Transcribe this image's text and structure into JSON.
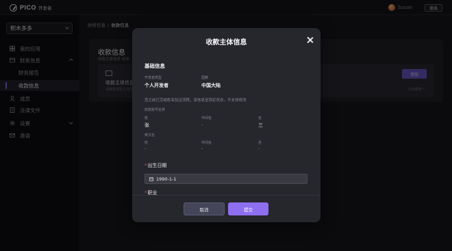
{
  "topbar": {
    "logo_text": "PICO",
    "logo_sub": "开发者",
    "username": "Susan",
    "logout_label": "退出"
  },
  "sidebar": {
    "app_name": "积木多多",
    "items": [
      {
        "label": "我的应用",
        "icon": "grid-icon"
      },
      {
        "label": "财务信息",
        "icon": "finance-icon"
      },
      {
        "label": "财务报告"
      },
      {
        "label": "收款信息"
      },
      {
        "label": "成员",
        "icon": "member-icon"
      },
      {
        "label": "法律文件",
        "icon": "document-icon"
      },
      {
        "label": "设置",
        "icon": "gear-icon"
      },
      {
        "label": "邀请",
        "icon": "mail-icon"
      }
    ]
  },
  "main": {
    "breadcrumb": [
      "财务信息",
      "收款信息"
    ],
    "breadcrumb_sep": "/",
    "page_title": "收款信息",
    "page_desc": "收款主体信息 标准",
    "card_title": "收款主体信息",
    "card_sub": "请绑定收款主体信息",
    "card_right": "以仅绑定一",
    "add_label": "添加"
  },
  "modal": {
    "title": "收款主体信息",
    "section_title": "基础信息",
    "developer_type_label": "开发者类型",
    "developer_type_value": "个人开发者",
    "region_label": "国籍",
    "region_value": "中国大陆",
    "note": "您之前已完成姓名验证流程，该信息呈锁定状态，不支持修改",
    "account_name_label": "收款账号名称",
    "surname_label": "姓",
    "middle_label": "中间名",
    "given_label": "名",
    "surname_value": "张",
    "middle_value": "-",
    "given_value": "三",
    "english_name_label": "英文名",
    "en_surname_label": "姓",
    "en_middle_label": "中间名",
    "en_given_label": "名",
    "en_surname_value": "-",
    "en_middle_value": "-",
    "en_given_value": "-",
    "birth_label": "出生日期",
    "birth_value": "1990-1-1",
    "job_label": "职业",
    "required_mark": "*",
    "cancel_label": "取消",
    "submit_label": "提交"
  },
  "colors": {
    "accent": "#8d6ff0",
    "required": "#e0505a",
    "modal_bg": "#26262d"
  }
}
